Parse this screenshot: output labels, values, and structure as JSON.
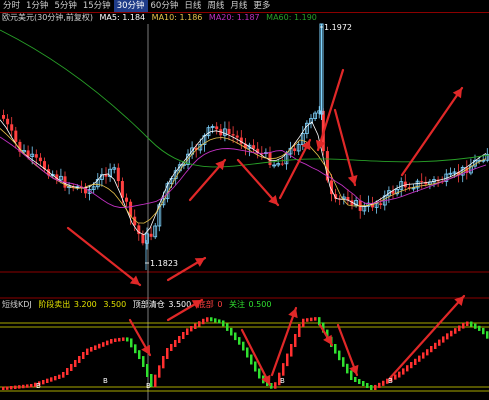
{
  "period_tabs": [
    {
      "label": "分时",
      "active": false
    },
    {
      "label": "1分钟",
      "active": false
    },
    {
      "label": "5分钟",
      "active": false
    },
    {
      "label": "15分钟",
      "active": false
    },
    {
      "label": "30分钟",
      "active": true
    },
    {
      "label": "60分钟",
      "active": false
    },
    {
      "label": "日线",
      "active": false
    },
    {
      "label": "周线",
      "active": false
    },
    {
      "label": "月线",
      "active": false
    },
    {
      "label": "更多",
      "active": false
    }
  ],
  "ma_legend": {
    "title": "欧元美元(30分钟,前复权)",
    "ma5": "MA5: 1.184",
    "ma10": "MA10: 1.186",
    "ma20": "MA20: 1.187",
    "ma60": "MA60: 1.190"
  },
  "price_high_label": "1.1972",
  "price_low_label": "1.1823",
  "indicator_legend": {
    "name": "短线KDJ",
    "sell_label": "阶段卖出",
    "sell_value": "3.200",
    "v2": "3.500",
    "clear_label": "顶部清仓",
    "clear_value": "3.500",
    "bottom_label": "底部",
    "bottom_value": "0",
    "watch_label": "关注",
    "watch_value": "0.500"
  },
  "buy_marker": "B",
  "colors": {
    "up": "#7fd4ff",
    "down": "#ff4040",
    "ma5": "#ffffff",
    "ma10": "#e8c24a",
    "ma20": "#c030c0",
    "ma60": "#28a028",
    "arrow": "#e02828",
    "kdj_up": "#ff3030",
    "kdj_down": "#30e030",
    "band": "#e0e000"
  }
}
